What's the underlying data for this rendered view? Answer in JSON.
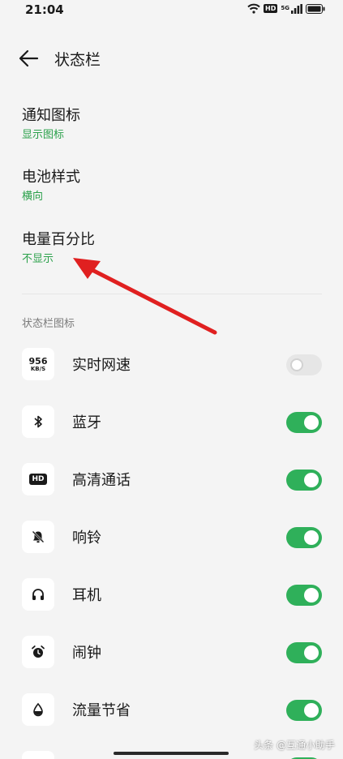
{
  "status_bar": {
    "time": "21:04",
    "hd_badge": "HD",
    "network_label": "5G"
  },
  "header": {
    "title": "状态栏"
  },
  "settings": [
    {
      "label": "通知图标",
      "value": "显示图标"
    },
    {
      "label": "电池样式",
      "value": "横向"
    },
    {
      "label": "电量百分比",
      "value": "不显示"
    }
  ],
  "section": {
    "title": "状态栏图标"
  },
  "icon_rows": [
    {
      "label": "实时网速",
      "icon": "network-speed-icon",
      "icon_text": "956",
      "icon_subtext": "KB/S",
      "enabled": false
    },
    {
      "label": "蓝牙",
      "icon": "bluetooth-icon",
      "enabled": true
    },
    {
      "label": "高清通话",
      "icon": "hd-call-icon",
      "icon_text": "HD",
      "enabled": true
    },
    {
      "label": "响铃",
      "icon": "bell-muted-icon",
      "enabled": true
    },
    {
      "label": "耳机",
      "icon": "headphones-icon",
      "enabled": true
    },
    {
      "label": "闹钟",
      "icon": "alarm-clock-icon",
      "enabled": true
    },
    {
      "label": "流量节省",
      "icon": "data-saver-icon",
      "enabled": true
    }
  ],
  "watermark": "头条 @互通小助手",
  "colors": {
    "accent_green": "#2fb05a",
    "arrow_red": "#e02020"
  }
}
